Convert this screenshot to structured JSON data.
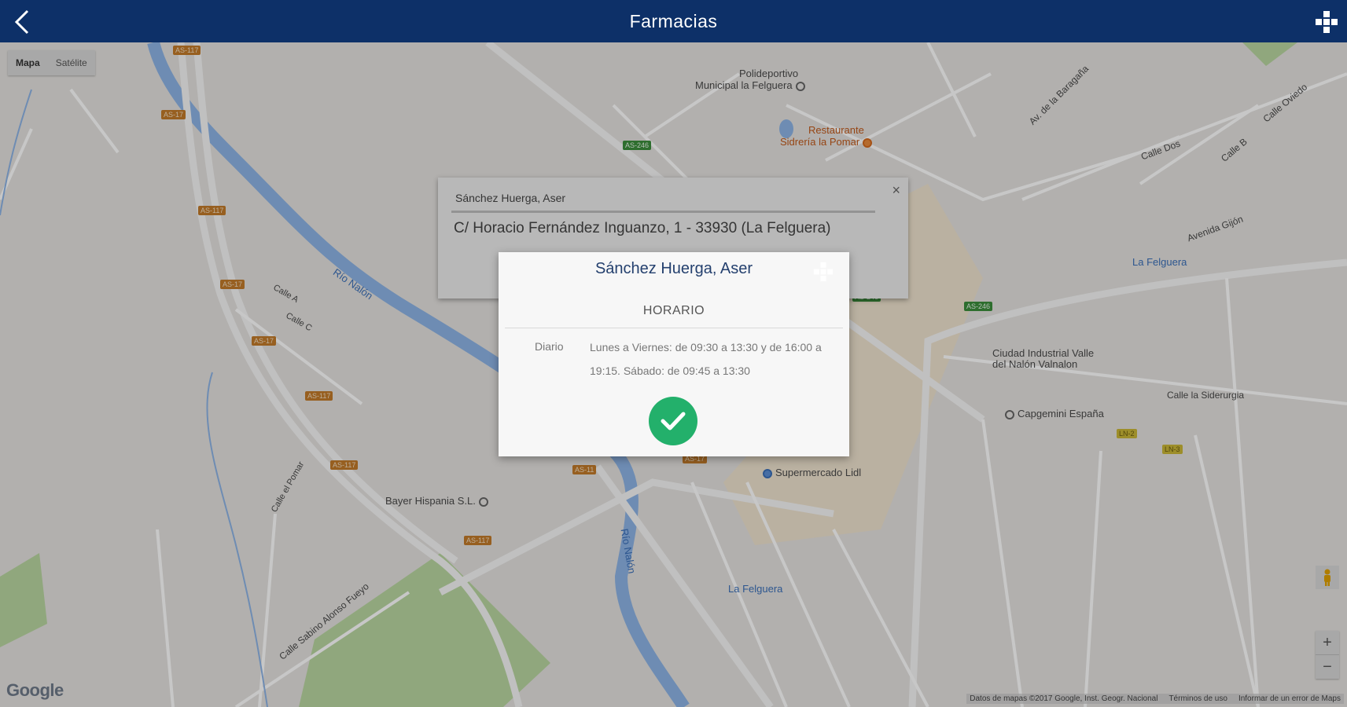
{
  "header": {
    "title": "Farmacias",
    "back_icon": "chevron-left-icon",
    "menu_icon": "cross-grid-icon"
  },
  "map": {
    "type_control": {
      "map": "Mapa",
      "satellite": "Satélite"
    },
    "labels": {
      "polideportivo": "Polideportivo",
      "polideportivo2": "Municipal la Felguera",
      "restaurante": "Restaurante",
      "restaurante2": "Sidrería la Pomar",
      "rio1": "Río Nalón",
      "rio2": "Río Nalón",
      "calle_c1": "Calle A",
      "calle_c2": "Calle C",
      "calle_pomar": "Calle el Pomar",
      "bayer": "Bayer Hispania S.L.",
      "ciudad1": "Ciudad Industrial Valle",
      "ciudad2": "del Nalón Valnalon",
      "capgemini": "Capgemini España",
      "lidl": "Supermercado Lidl",
      "lafelguera_bus": "La Felguera",
      "lafelguera_st": "La Felguera",
      "siderurgia": "Calle la Siderurgia",
      "avenida": "Avenida Gijón",
      "av_baragana": "Av. de la Baragaña",
      "calle_oviedo": "Calle Oviedo",
      "calle_dos": "Calle Dos",
      "calle_b": "Calle B",
      "calle_sabino": "Calle Sabino Alonso Fueyo"
    },
    "shields": {
      "s1": "AS-117",
      "s2": "AS-17",
      "s3": "AS-117",
      "s4": "AS-17",
      "s5": "AS-17",
      "s6": "AS-117",
      "s7": "AS-117",
      "s8": "AS-117",
      "s9": "AS-11",
      "s10": "AS-17",
      "s11": "AS-246",
      "s12": "AS-246",
      "s13": "AS-246",
      "s14": "LN-2",
      "s15": "LN-3"
    },
    "google": "Google",
    "attribution": {
      "data": "Datos de mapas ©2017 Google, Inst. Geogr. Nacional",
      "terms": "Términos de uso",
      "report": "Informar de un error de Maps"
    },
    "zoom": {
      "in": "+",
      "out": "−"
    }
  },
  "info_window": {
    "name": "Sánchez Huerga, Aser",
    "address": "C/ Horacio Fernández Inguanzo, 1 - 33930 (La Felguera)",
    "close": "×"
  },
  "modal": {
    "title": "Sánchez Huerga, Aser",
    "section": "HORARIO",
    "day": "Diario",
    "hours": "Lunes a Viernes: de 09:30 a 13:30 y de 16:00 a 19:15. Sábado: de 09:45 a 13:30",
    "confirm_icon": "check-icon"
  },
  "colors": {
    "header": "#0d3068",
    "confirm": "#23b06b",
    "river": "#6f9fd8",
    "park": "#9bbf7a"
  }
}
